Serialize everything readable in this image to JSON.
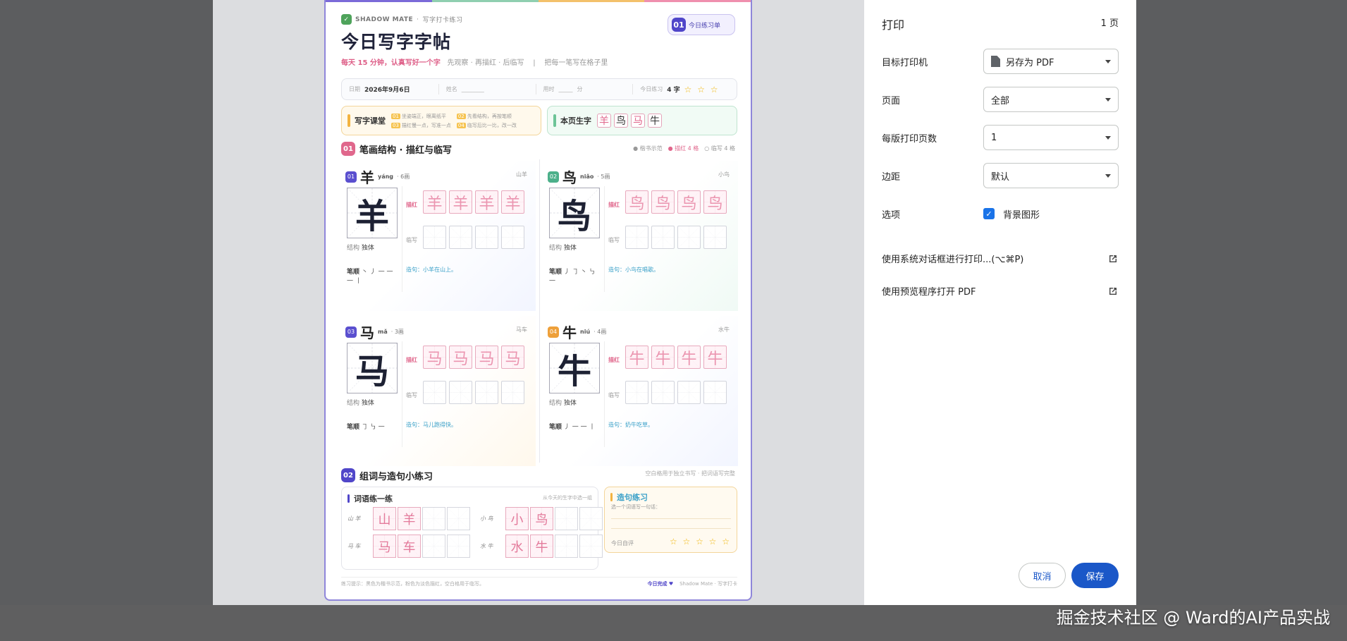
{
  "sheet": {
    "brand": {
      "name": "SHADOW MATE",
      "sep": "·",
      "sub": "写字打卡练习",
      "logo_icon": "checkin-logo-icon"
    },
    "title": "今日写字字帖",
    "tagline": {
      "pink": "每天 15 分钟，认真写好一个字",
      "steps": "先观察 · 再描红 · 后临写",
      "sep": "|",
      "note": "把每一笔写在格子里"
    },
    "badge": {
      "num": "01",
      "label": "今日练习单"
    },
    "info": {
      "date_label": "日期",
      "date_value": "2026年9月6日",
      "name_label": "姓名",
      "name_blank": "________",
      "time_label": "用时",
      "time_blank": "_____",
      "time_unit": "分",
      "today_label": "今日练习",
      "today_value": "4 字",
      "stars": "☆ ☆ ☆"
    },
    "classroom": {
      "title": "写字课堂",
      "tips": [
        {
          "n": "01",
          "t": "坐姿端正，眼离纸平"
        },
        {
          "n": "02",
          "t": "先看结构，再按笔顺"
        },
        {
          "n": "03",
          "t": "描红慢一点，写准一点"
        },
        {
          "n": "04",
          "t": "临写后比一比，改一改"
        }
      ]
    },
    "new_chars": {
      "title": "本页生字",
      "chars": [
        "羊",
        "鸟",
        "马",
        "牛"
      ]
    },
    "section1": {
      "num": "01",
      "title": "笔画结构 · 描红与临写"
    },
    "legend": {
      "a": "● 楷书示范",
      "b": "● 描红 4 格",
      "c": "○ 临写 4 格"
    },
    "labels": {
      "trace": "描红",
      "copy": "临写",
      "struct": "结构",
      "order": "笔顺",
      "sentence": "造句："
    },
    "cards": [
      {
        "num": "01",
        "color": "#5a4fcf",
        "char": "羊",
        "pinyin": "yáng",
        "strokes": "· 6画",
        "meaning": "山羊",
        "structure": "独体",
        "order": "丶 丿 一 一 一 丨",
        "sentence": "小羊在山上。"
      },
      {
        "num": "02",
        "color": "#4cb08a",
        "char": "鸟",
        "pinyin": "niǎo",
        "strokes": "· 5画",
        "meaning": "小鸟",
        "structure": "独体",
        "order": "丿 ㇆ 丶 ㇉ 一",
        "sentence": "小鸟在唱歌。"
      },
      {
        "num": "03",
        "color": "#5a4fcf",
        "char": "马",
        "pinyin": "mǎ",
        "strokes": "· 3画",
        "meaning": "马车",
        "structure": "独体",
        "order": "㇆ ㇉ 一",
        "sentence": "马儿跑得快。"
      },
      {
        "num": "04",
        "color": "#eea03a",
        "char": "牛",
        "pinyin": "niú",
        "strokes": "· 4画",
        "meaning": "水牛",
        "structure": "独体",
        "order": "丿 一 一 丨",
        "sentence": "奶牛吃草。"
      }
    ],
    "section2": {
      "num": "02",
      "title": "组词与造句小练习",
      "hint": "空白格用于独立书写 · 把词语写完整"
    },
    "words": {
      "title": "词语练一练",
      "hint": "从今天的生字中选一组",
      "groups": [
        {
          "label": "山 羊",
          "chars": [
            "山",
            "羊"
          ]
        },
        {
          "label": "小 鸟",
          "chars": [
            "小",
            "鸟"
          ]
        },
        {
          "label": "马 车",
          "chars": [
            "马",
            "车"
          ]
        },
        {
          "label": "水 牛",
          "chars": [
            "水",
            "牛"
          ]
        }
      ]
    },
    "sentence_box": {
      "title": "造句练习",
      "sub": "选一个词语写一句话：",
      "self": "今日自评",
      "stars": "☆ ☆ ☆ ☆ ☆"
    },
    "footer": {
      "left": "练习提示：黑色为楷书示范，粉色为淡色描红，空白格用于临写。",
      "done": "今日完成 ♥",
      "brand": "Shadow Mate · 写字打卡"
    }
  },
  "print": {
    "title": "打印",
    "pages": "1 页",
    "printer_label": "目标打印机",
    "printer_value": "另存为 PDF",
    "pages_label": "页面",
    "pages_value": "全部",
    "per_sheet_label": "每版打印页数",
    "per_sheet_value": "1",
    "margin_label": "边距",
    "margin_value": "默认",
    "options_label": "选项",
    "bg_label": "背景图形",
    "system_dialog": "使用系统对话框进行打印...(⌥⌘P)",
    "open_preview": "使用预览程序打开 PDF",
    "cancel": "取消",
    "save": "保存"
  },
  "watermark": "掘金技术社区 @ Ward的AI产品实战",
  "colors": {
    "accent": "#1a57c8",
    "pink": "#e0678c",
    "purple": "#5046c9",
    "green": "#4cb08a",
    "yellow": "#eea03a"
  }
}
